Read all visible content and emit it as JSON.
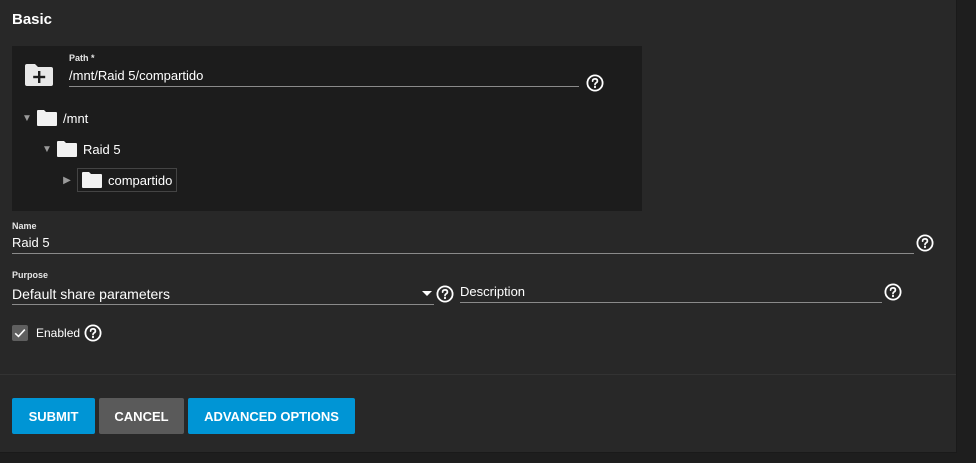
{
  "section": {
    "title": "Basic"
  },
  "path": {
    "label": "Path *",
    "value": "/mnt/Raid 5/compartido",
    "icon": "create-new-folder-icon"
  },
  "tree": {
    "items": [
      {
        "label": "/mnt",
        "expanded": true
      },
      {
        "label": "Raid 5",
        "expanded": true
      },
      {
        "label": "compartido",
        "expanded": false
      }
    ]
  },
  "name": {
    "label": "Name",
    "value": "Raid 5"
  },
  "purpose": {
    "label": "Purpose",
    "value": "Default share parameters"
  },
  "description": {
    "placeholder": "Description"
  },
  "enabled": {
    "label": "Enabled",
    "checked": true
  },
  "buttons": {
    "submit": "SUBMIT",
    "cancel": "CANCEL",
    "advanced": "ADVANCED OPTIONS"
  },
  "colors": {
    "primary": "#0095d5",
    "secondary": "#5a5a5a",
    "background": "#282828"
  }
}
